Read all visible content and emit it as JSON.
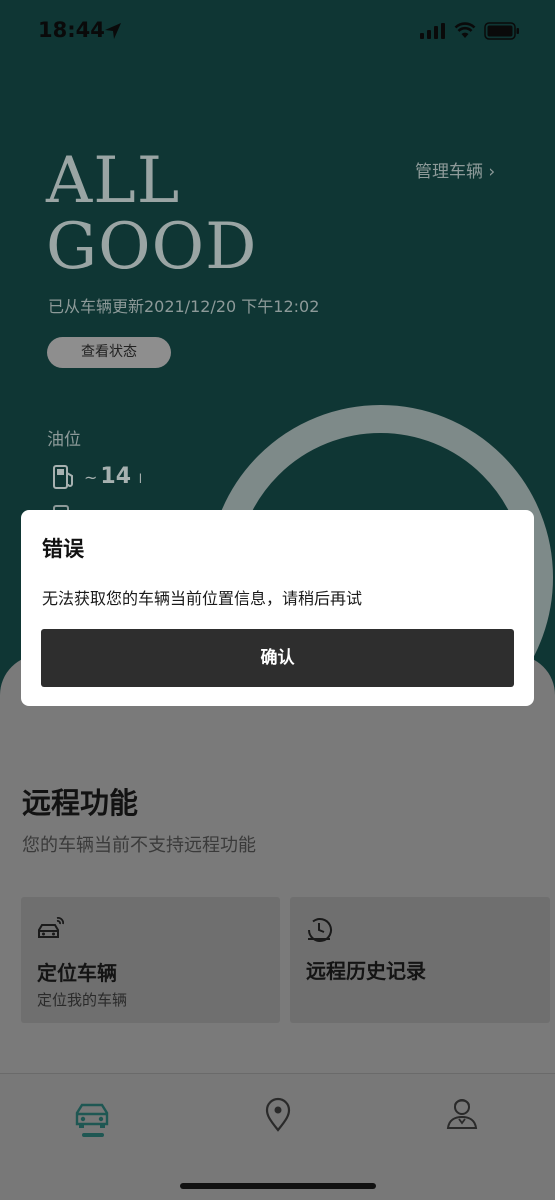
{
  "status_bar": {
    "time": "18:44"
  },
  "hero": {
    "title_line1": "ALL",
    "title_line2": "GOOD",
    "manage_link": "管理车辆 ›",
    "update_text": "已从车辆更新2021/12/20 下午12:02",
    "status_button": "查看状态",
    "fuel_label": "油位",
    "fuel_tilde": "~",
    "fuel_value": "14",
    "fuel_unit": "l"
  },
  "remote": {
    "title": "远程功能",
    "subtitle": "您的车辆当前不支持远程功能",
    "cards": [
      {
        "title": "定位车辆",
        "subtitle": "定位我的车辆",
        "icon": "car-locate-icon"
      },
      {
        "title": "远程历史记录",
        "icon": "history-clock-icon"
      }
    ]
  },
  "tabbar": {
    "tabs": [
      {
        "icon": "car-icon",
        "active": true
      },
      {
        "icon": "location-pin-icon",
        "active": false
      },
      {
        "icon": "concierge-person-icon",
        "active": false
      }
    ]
  },
  "dialog": {
    "title": "错误",
    "message": "无法获取您的车辆当前位置信息，请稍后再试",
    "confirm_label": "确认"
  },
  "colors": {
    "hero_bg": "#0f3634",
    "dialog_button": "#2e2e2e",
    "accent_tab": "#1f5753"
  }
}
